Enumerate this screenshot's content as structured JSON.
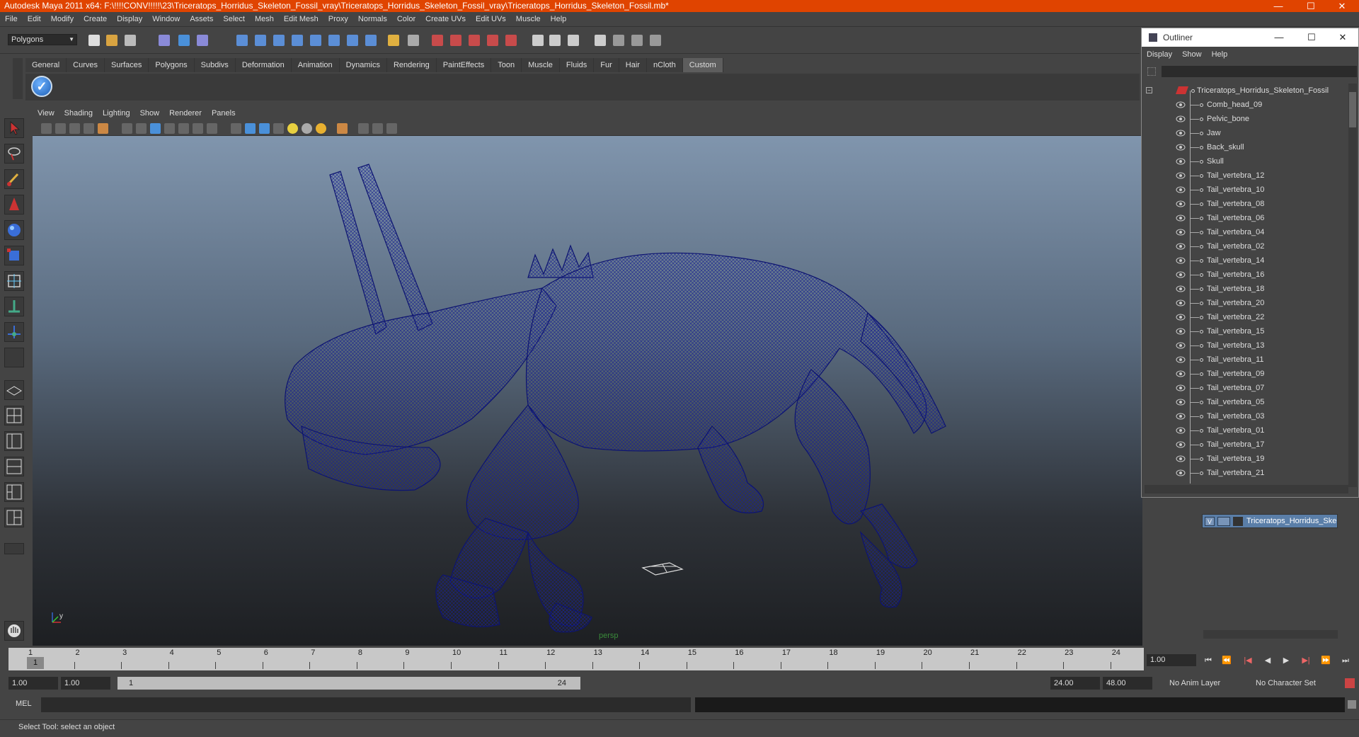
{
  "window": {
    "title": "Autodesk Maya 2011 x64: F:\\!!!!CONV!!!!!\\23\\Triceratops_Horridus_Skeleton_Fossil_vray\\Triceratops_Horridus_Skeleton_Fossil_vray\\Triceratops_Horridus_Skeleton_Fossil.mb*",
    "minimize": "—",
    "maximize": "☐",
    "close": "✕"
  },
  "menubar": [
    "File",
    "Edit",
    "Modify",
    "Create",
    "Display",
    "Window",
    "Assets",
    "Select",
    "Mesh",
    "Edit Mesh",
    "Proxy",
    "Normals",
    "Color",
    "Create UVs",
    "Edit UVs",
    "Muscle",
    "Help"
  ],
  "statusline": {
    "mode": "Polygons"
  },
  "shelf": {
    "tabs": [
      "General",
      "Curves",
      "Surfaces",
      "Polygons",
      "Subdivs",
      "Deformation",
      "Animation",
      "Dynamics",
      "Rendering",
      "PaintEffects",
      "Toon",
      "Muscle",
      "Fluids",
      "Fur",
      "Hair",
      "nCloth",
      "Custom"
    ],
    "active_tab": "Custom"
  },
  "viewport": {
    "menu": [
      "View",
      "Shading",
      "Lighting",
      "Show",
      "Renderer",
      "Panels"
    ],
    "camera_label": "persp",
    "wire_color": "#0d1470"
  },
  "outliner": {
    "title": "Outliner",
    "menu": [
      "Display",
      "Show",
      "Help"
    ],
    "root": "Triceratops_Horridus_Skeleton_Fossil",
    "items": [
      "Comb_head_09",
      "Pelvic_bone",
      "Jaw",
      "Back_skull",
      "Skull",
      "Tail_vertebra_12",
      "Tail_vertebra_10",
      "Tail_vertebra_08",
      "Tail_vertebra_06",
      "Tail_vertebra_04",
      "Tail_vertebra_02",
      "Tail_vertebra_14",
      "Tail_vertebra_16",
      "Tail_vertebra_18",
      "Tail_vertebra_20",
      "Tail_vertebra_22",
      "Tail_vertebra_15",
      "Tail_vertebra_13",
      "Tail_vertebra_11",
      "Tail_vertebra_09",
      "Tail_vertebra_07",
      "Tail_vertebra_05",
      "Tail_vertebra_03",
      "Tail_vertebra_01",
      "Tail_vertebra_17",
      "Tail_vertebra_19",
      "Tail_vertebra_21"
    ]
  },
  "layers": {
    "visible_flag": "V",
    "layer_name": "Triceratops_Horridus_Skeleton_Fossil"
  },
  "timeline": {
    "ticks": [
      1,
      2,
      3,
      4,
      5,
      6,
      7,
      8,
      9,
      10,
      11,
      12,
      13,
      14,
      15,
      16,
      17,
      18,
      19,
      20,
      21,
      22,
      23,
      24
    ],
    "current_frame": "1",
    "current_time_field": "1.00",
    "playback_buttons": [
      "⏮",
      "⏪",
      "|◀",
      "◀",
      "▶",
      "▶|",
      "⏩",
      "⏭"
    ]
  },
  "range": {
    "start_time": "1.00",
    "playback_start": "1.00",
    "range_low": "1",
    "range_high": "24",
    "playback_end": "24.00",
    "end_time": "48.00",
    "anim_layer": "No Anim Layer",
    "character_set": "No Character Set"
  },
  "commandline": {
    "label": "MEL"
  },
  "helpline": {
    "text": "Select Tool: select an object"
  }
}
